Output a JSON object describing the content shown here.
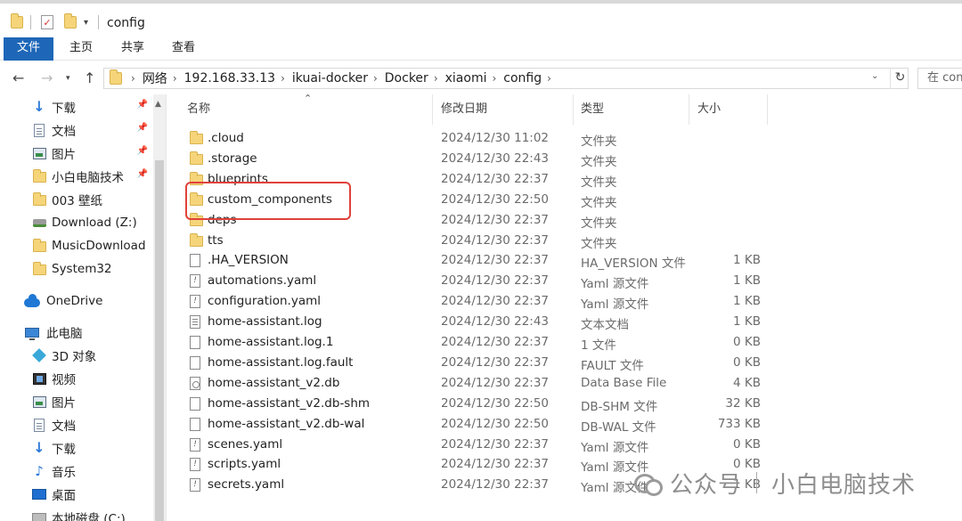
{
  "window": {
    "title": "config"
  },
  "ribbon": {
    "tabs": [
      "文件",
      "主页",
      "共享",
      "查看"
    ]
  },
  "address": {
    "crumbs": [
      "网络",
      "192.168.33.13",
      "ikuai-docker",
      "Docker",
      "xiaomi",
      "config"
    ],
    "search_placeholder": "在 config"
  },
  "nav": {
    "items": [
      {
        "label": "下载",
        "icon": "download-icon",
        "pinned": true
      },
      {
        "label": "文档",
        "icon": "document-icon",
        "pinned": true
      },
      {
        "label": "图片",
        "icon": "picture-icon",
        "pinned": true
      },
      {
        "label": "小白电脑技术",
        "icon": "folder-icon",
        "pinned": true
      },
      {
        "label": "003 壁纸",
        "icon": "folder-icon",
        "pinned": false
      },
      {
        "label": "Download (Z:)",
        "icon": "network-drive-icon",
        "pinned": false
      },
      {
        "label": "MusicDownload",
        "icon": "folder-icon",
        "pinned": false
      },
      {
        "label": "System32",
        "icon": "folder-icon",
        "pinned": false
      },
      {
        "label": "OneDrive",
        "icon": "onedrive-icon",
        "pinned": false
      },
      {
        "label": "此电脑",
        "icon": "this-pc-icon",
        "pinned": false
      },
      {
        "label": "3D 对象",
        "icon": "3d-objects-icon",
        "pinned": false
      },
      {
        "label": "视频",
        "icon": "video-icon",
        "pinned": false
      },
      {
        "label": "图片",
        "icon": "picture-icon",
        "pinned": false
      },
      {
        "label": "文档",
        "icon": "document-icon",
        "pinned": false
      },
      {
        "label": "下载",
        "icon": "download-icon",
        "pinned": false
      },
      {
        "label": "音乐",
        "icon": "music-icon",
        "pinned": false
      },
      {
        "label": "桌面",
        "icon": "desktop-icon",
        "pinned": false
      },
      {
        "label": "本地磁盘 (C:)",
        "icon": "local-disk-icon",
        "pinned": false
      }
    ]
  },
  "columns": {
    "name": "名称",
    "date": "修改日期",
    "type": "类型",
    "size": "大小"
  },
  "files": [
    {
      "name": ".cloud",
      "date": "2024/12/30 11:02",
      "type": "文件夹",
      "size": "",
      "icon": "folder"
    },
    {
      "name": ".storage",
      "date": "2024/12/30 22:43",
      "type": "文件夹",
      "size": "",
      "icon": "folder"
    },
    {
      "name": "blueprints",
      "date": "2024/12/30 22:37",
      "type": "文件夹",
      "size": "",
      "icon": "folder"
    },
    {
      "name": "custom_components",
      "date": "2024/12/30 22:50",
      "type": "文件夹",
      "size": "",
      "icon": "folder"
    },
    {
      "name": "deps",
      "date": "2024/12/30 22:37",
      "type": "文件夹",
      "size": "",
      "icon": "folder"
    },
    {
      "name": "tts",
      "date": "2024/12/30 22:37",
      "type": "文件夹",
      "size": "",
      "icon": "folder"
    },
    {
      "name": ".HA_VERSION",
      "date": "2024/12/30 22:37",
      "type": "HA_VERSION 文件",
      "size": "1 KB",
      "icon": "file"
    },
    {
      "name": "automations.yaml",
      "date": "2024/12/30 22:37",
      "type": "Yaml 源文件",
      "size": "1 KB",
      "icon": "yaml"
    },
    {
      "name": "configuration.yaml",
      "date": "2024/12/30 22:37",
      "type": "Yaml 源文件",
      "size": "1 KB",
      "icon": "yaml"
    },
    {
      "name": "home-assistant.log",
      "date": "2024/12/30 22:43",
      "type": "文本文档",
      "size": "1 KB",
      "icon": "log"
    },
    {
      "name": "home-assistant.log.1",
      "date": "2024/12/30 22:37",
      "type": "1 文件",
      "size": "0 KB",
      "icon": "file"
    },
    {
      "name": "home-assistant.log.fault",
      "date": "2024/12/30 22:37",
      "type": "FAULT 文件",
      "size": "0 KB",
      "icon": "file"
    },
    {
      "name": "home-assistant_v2.db",
      "date": "2024/12/30 22:37",
      "type": "Data Base File",
      "size": "4 KB",
      "icon": "db"
    },
    {
      "name": "home-assistant_v2.db-shm",
      "date": "2024/12/30 22:50",
      "type": "DB-SHM 文件",
      "size": "32 KB",
      "icon": "file"
    },
    {
      "name": "home-assistant_v2.db-wal",
      "date": "2024/12/30 22:50",
      "type": "DB-WAL 文件",
      "size": "733 KB",
      "icon": "file"
    },
    {
      "name": "scenes.yaml",
      "date": "2024/12/30 22:37",
      "type": "Yaml 源文件",
      "size": "0 KB",
      "icon": "yaml"
    },
    {
      "name": "scripts.yaml",
      "date": "2024/12/30 22:37",
      "type": "Yaml 源文件",
      "size": "0 KB",
      "icon": "yaml"
    },
    {
      "name": "secrets.yaml",
      "date": "2024/12/30 22:37",
      "type": "Yaml 源文件",
      "size": "1 KB",
      "icon": "yaml"
    }
  ],
  "watermark": {
    "left": "公众号",
    "right": "小白电脑技术"
  },
  "colors": {
    "accent": "#1e67b8",
    "highlight": "#e0413a",
    "folder": "#f6d57a"
  }
}
